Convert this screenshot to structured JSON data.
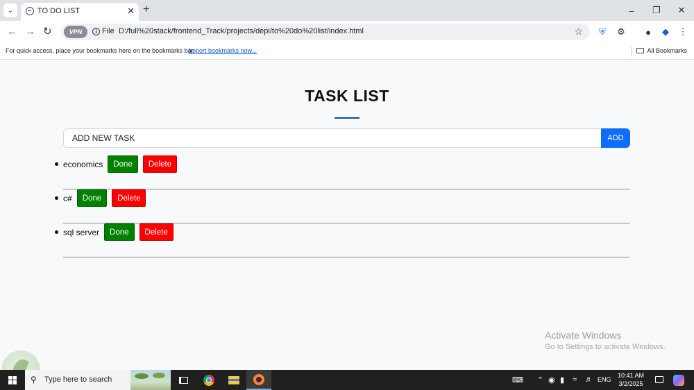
{
  "browser": {
    "tab_title": "TO DO LIST",
    "url_scheme_label": "File",
    "url": "D:/full%20stack/frontend_Track/projects/depi/to%20do%20list/index.html",
    "vpn_label": "VPN",
    "bookmarks_bar_text": "For quick access, place your bookmarks here on the bookmarks bar.",
    "import_bookmarks_link": "Import bookmarks now...",
    "all_bookmarks_label": "All Bookmarks"
  },
  "page": {
    "title": "TASK LIST",
    "input_placeholder": "ADD NEW TASK",
    "add_button_label": "ADD",
    "tasks": [
      {
        "name": "economics",
        "done_label": "Done",
        "delete_label": "Delete"
      },
      {
        "name": "c#",
        "done_label": "Done",
        "delete_label": "Delete"
      },
      {
        "name": "sql server",
        "done_label": "Done",
        "delete_label": "Delete"
      }
    ]
  },
  "watermark": {
    "title": "Activate Windows",
    "subtitle": "Go to Settings to activate Windows."
  },
  "taskbar": {
    "search_placeholder": "Type here to search",
    "language": "ENG",
    "time": "10:41 AM",
    "date": "3/2/2025"
  },
  "icons": {
    "tab_search": "chevron-down-icon",
    "back": "arrow-left-icon",
    "forward": "arrow-right-icon",
    "reload": "reload-icon",
    "bookmark_star": "star-icon",
    "extensions": "puzzle-icon",
    "profile": "profile-icon",
    "shield": "shield-icon",
    "menu": "kebab-menu-icon"
  },
  "colors": {
    "add_button": "#0d6efd",
    "done_button": "#008000",
    "delete_button": "#ff0000",
    "title_underline": "#0d47a1",
    "page_background": "#f8f9fa",
    "taskbar_background": "#202020"
  }
}
